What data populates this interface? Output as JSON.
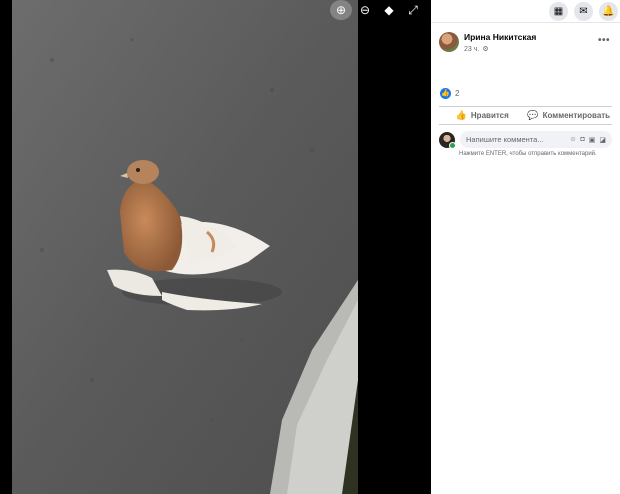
{
  "viewer": {
    "tools": [
      {
        "name": "zoom-in-icon",
        "glyph": "⊕"
      },
      {
        "name": "zoom-out-icon",
        "glyph": "⊖"
      },
      {
        "name": "tag-icon",
        "glyph": "◆"
      },
      {
        "name": "fullscreen-icon",
        "glyph": "⤢"
      }
    ]
  },
  "topbar": {
    "icons": [
      "menu-grid-icon",
      "messenger-icon",
      "notifications-icon"
    ]
  },
  "post": {
    "author": "Ирина Никитская",
    "time": "23 ч.",
    "more": "•••",
    "reaction_count": "2",
    "like_label": "Нравится",
    "comment_label": "Комментировать",
    "comment_placeholder": "Напишите коммента...",
    "hint": "Нажмите ENTER, чтобы отправить комментарий."
  },
  "colors": {
    "accent": "#1877f2",
    "online": "#31a24c",
    "muted": "#65676b"
  }
}
